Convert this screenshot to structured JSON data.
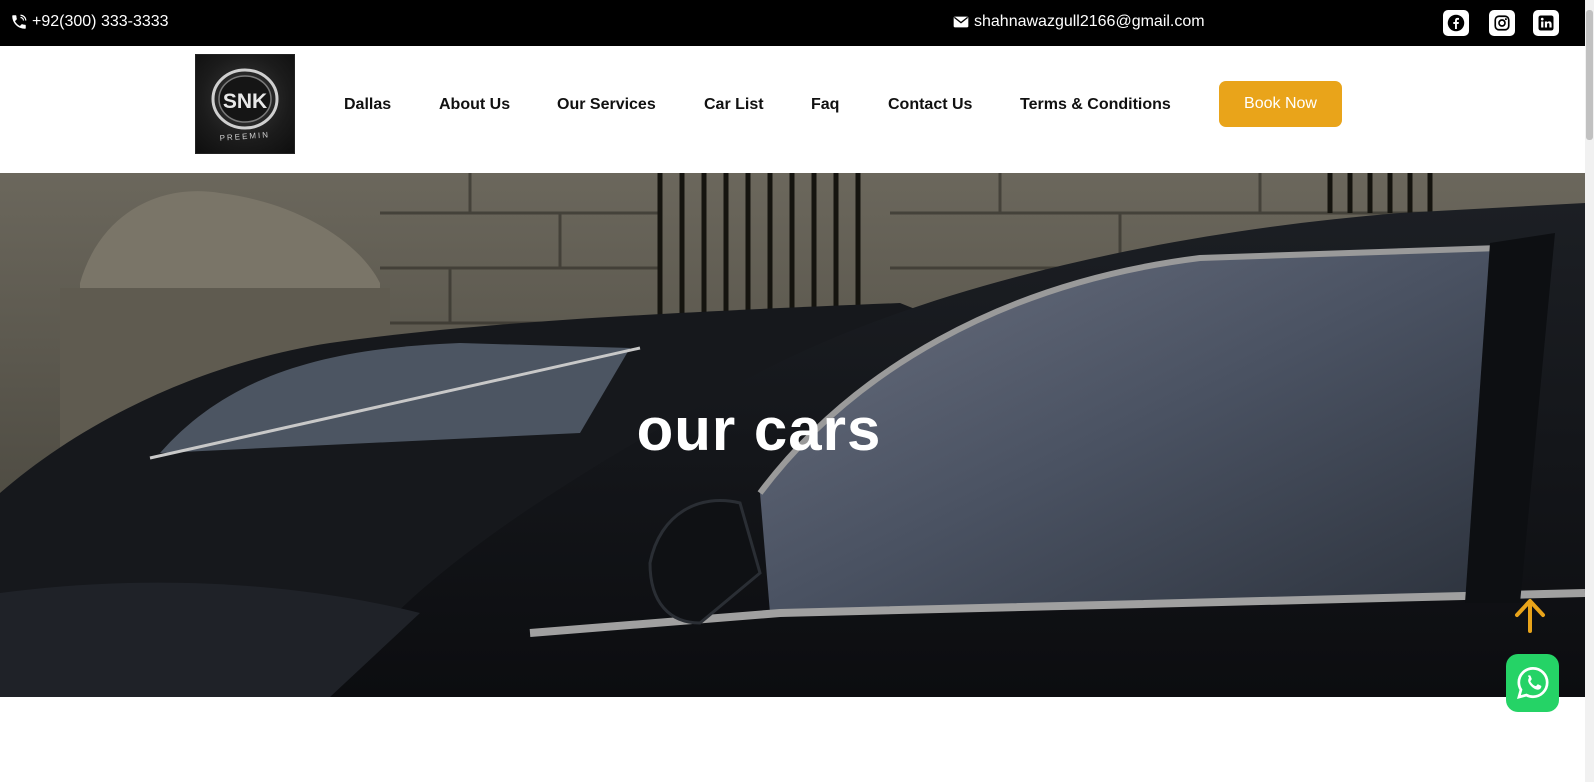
{
  "topbar": {
    "phone": "+92(300) 333-3333",
    "email": "shahnawazgull2166@gmail.com",
    "social_icons": [
      "facebook-icon",
      "instagram-icon",
      "linkedin-icon"
    ]
  },
  "logo": {
    "text": "SNK",
    "subtext": "PREEMIN"
  },
  "nav": {
    "items": [
      "Dallas",
      "About Us",
      "Our Services",
      "Car List",
      "Faq",
      "Contact Us",
      "Terms & Conditions"
    ],
    "cta": "Book Now"
  },
  "hero": {
    "title": "our cars"
  },
  "colors": {
    "accent": "#e9a41a",
    "topbar": "#000000",
    "whatsapp": "#25d366"
  }
}
